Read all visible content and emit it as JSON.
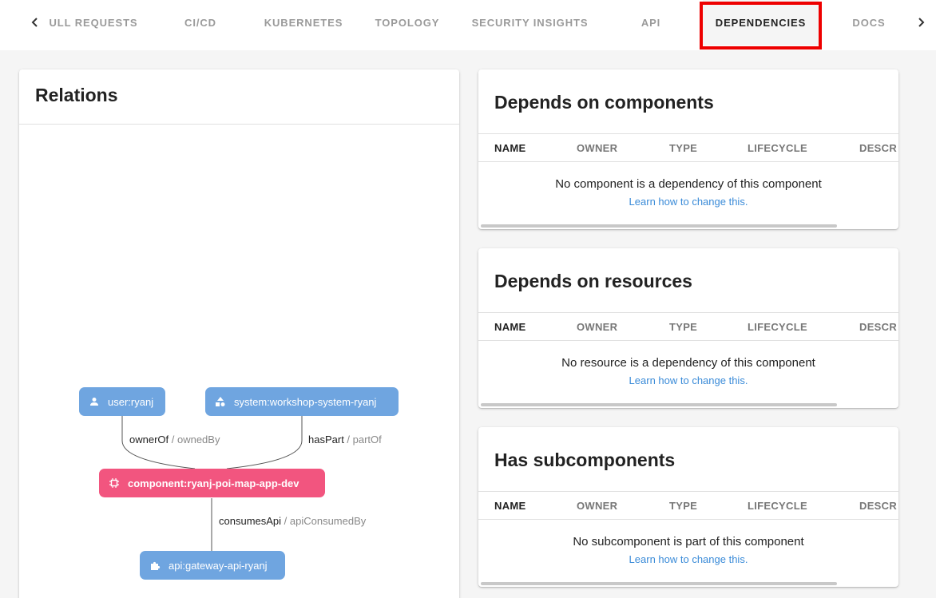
{
  "tabs": [
    {
      "label": "ULL REQUESTS",
      "active": false
    },
    {
      "label": "CI/CD",
      "active": false
    },
    {
      "label": "KUBERNETES",
      "active": false
    },
    {
      "label": "TOPOLOGY",
      "active": false
    },
    {
      "label": "SECURITY INSIGHTS",
      "active": false
    },
    {
      "label": "API",
      "active": false
    },
    {
      "label": "DEPENDENCIES",
      "active": true
    },
    {
      "label": "DOCS",
      "active": false
    }
  ],
  "colors": {
    "highlight": "#ee0000",
    "node_blue": "#6fa5e0",
    "node_pink": "#f2557f",
    "link": "#3a8bd8"
  },
  "relations": {
    "title": "Relations",
    "nodes": {
      "user": {
        "label": "user:ryanj",
        "icon": "person-icon"
      },
      "system": {
        "label": "system:workshop-system-ryanj",
        "icon": "shapes-icon"
      },
      "component": {
        "label": "component:ryanj-poi-map-app-dev",
        "icon": "chip-icon"
      },
      "api": {
        "label": "api:gateway-api-ryanj",
        "icon": "puzzle-icon"
      }
    },
    "edges": {
      "owner": {
        "forward": "ownerOf",
        "reverse": " / ownedBy"
      },
      "part": {
        "forward": "hasPart",
        "reverse": " / partOf"
      },
      "api": {
        "forward": "consumesApi",
        "reverse": " / apiConsumedBy"
      }
    }
  },
  "columns": [
    "NAME",
    "OWNER",
    "TYPE",
    "LIFECYCLE",
    "DESCR"
  ],
  "sections": [
    {
      "title": "Depends on components",
      "empty": "No component is a dependency of this component",
      "link": "Learn how to change this."
    },
    {
      "title": "Depends on resources",
      "empty": "No resource is a dependency of this component",
      "link": "Learn how to change this."
    },
    {
      "title": "Has subcomponents",
      "empty": "No subcomponent is part of this component",
      "link": "Learn how to change this."
    }
  ]
}
